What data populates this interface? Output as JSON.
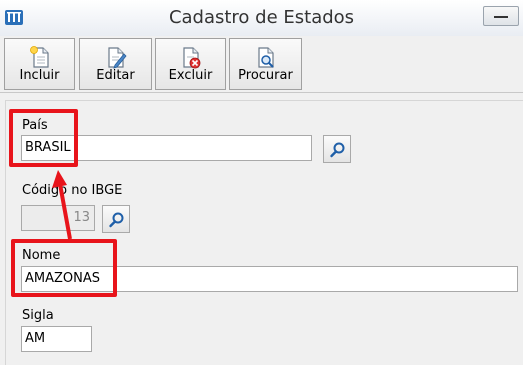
{
  "window": {
    "title": "Cadastro de Estados"
  },
  "toolbar": {
    "buttons": [
      {
        "label": "Incluir",
        "icon": "new-document-icon"
      },
      {
        "label": "Editar",
        "icon": "edit-document-icon"
      },
      {
        "label": "Excluir",
        "icon": "delete-document-icon"
      },
      {
        "label": "Procurar",
        "icon": "search-document-icon"
      }
    ]
  },
  "form": {
    "pais": {
      "label": "País",
      "value": "BRASIL"
    },
    "ibge": {
      "label": "Código no IBGE",
      "value": "13"
    },
    "nome": {
      "label": "Nome",
      "value": "AMAZONAS"
    },
    "sigla": {
      "label": "Sigla",
      "value": "AM"
    }
  },
  "colors": {
    "annotation": "#e8141b",
    "search_icon": "#1f5fa8"
  }
}
